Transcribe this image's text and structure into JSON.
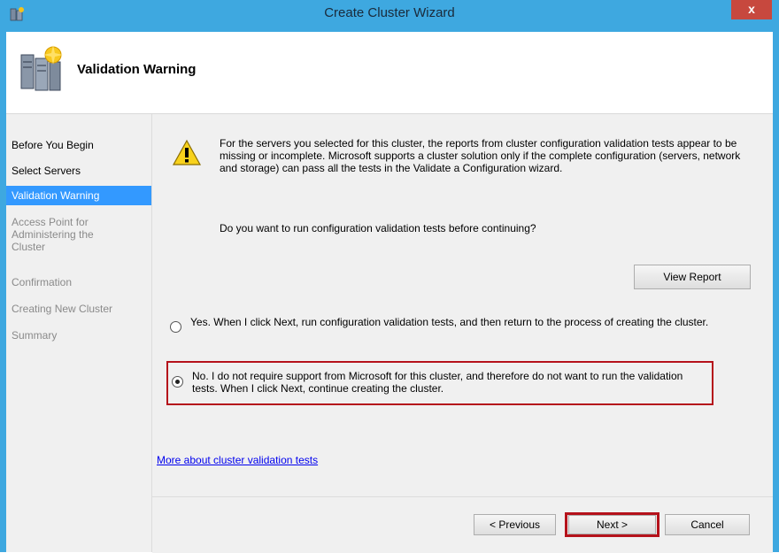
{
  "window": {
    "title": "Create Cluster Wizard",
    "close_label": "x"
  },
  "header": {
    "title": "Validation Warning"
  },
  "nav": {
    "items": [
      {
        "label": "Before You Begin",
        "state": "done"
      },
      {
        "label": "Select Servers",
        "state": "done"
      },
      {
        "label": "Validation Warning",
        "state": "current"
      },
      {
        "label": "Access Point for Administering the Cluster",
        "state": "todo"
      },
      {
        "label": "Confirmation",
        "state": "todo"
      },
      {
        "label": "Creating New Cluster",
        "state": "todo"
      },
      {
        "label": "Summary",
        "state": "todo"
      }
    ]
  },
  "content": {
    "message": "For the servers you selected for this cluster, the reports from cluster configuration validation tests appear to be missing or incomplete.  Microsoft supports a cluster solution only if the complete configuration (servers, network and storage) can pass all the tests in the Validate a Configuration wizard.",
    "question": "Do you want to run configuration validation tests before continuing?",
    "view_report_label": "View Report",
    "option_yes": {
      "label": "Yes.  When I click Next, run configuration validation tests, and then return to the process of creating the cluster.",
      "selected": false
    },
    "option_no": {
      "label": "No.  I do not require support from Microsoft for this cluster, and therefore do not want to run the validation tests.  When I click Next, continue creating the cluster.",
      "selected": true
    },
    "link_label": "More about cluster validation tests"
  },
  "footer": {
    "previous_label": "< Previous",
    "next_label": "Next >",
    "cancel_label": "Cancel"
  },
  "colors": {
    "titlebar": "#3ea8e0",
    "nav_selected": "#3399ff",
    "highlight_border": "#b5121b",
    "link": "#0000ee"
  }
}
